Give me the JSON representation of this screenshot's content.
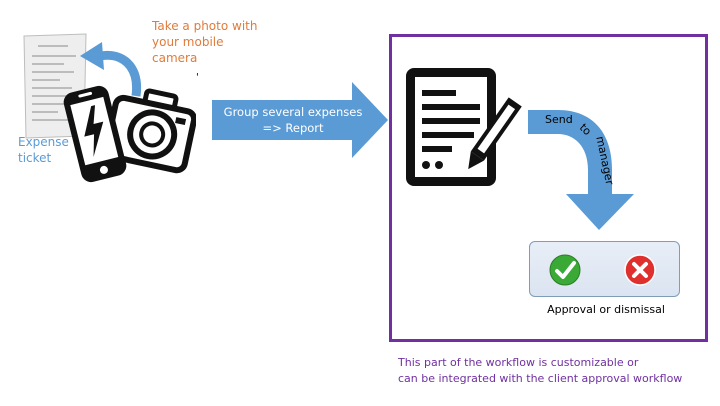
{
  "phone_step": {
    "caption": "Take a photo with your mobile camera",
    "ticket_label": "Expense ticket",
    "stray_mark": "'"
  },
  "group_step": {
    "label": "Group several expenses => Report"
  },
  "send_step": {
    "word_send": "Send",
    "word_to": "to",
    "word_manager": "manager"
  },
  "decision": {
    "label": "Approval or dismissal"
  },
  "note": {
    "line1": "This part of the workflow is customizable or",
    "line2": "can be integrated with the client approval workflow"
  },
  "colors": {
    "arrow_blue": "#5b9bd5",
    "caption_orange": "#e07b39",
    "workflow_purple": "#7030a0",
    "approve_green": "#3aa935",
    "dismiss_red": "#e0302e"
  }
}
